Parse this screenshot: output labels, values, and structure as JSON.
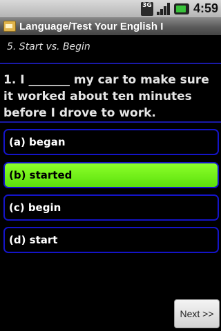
{
  "status": {
    "network": "3G",
    "time": "4:59",
    "icons": [
      "3g-icon",
      "signal-icon",
      "battery-icon"
    ]
  },
  "app": {
    "title": "Language/Test Your English I"
  },
  "section": {
    "subtitle": "5. Start vs. Begin"
  },
  "question": {
    "text": "1. I _______ my car to make sure it worked about ten minutes before I drove to work."
  },
  "options": [
    {
      "label": "(a) began",
      "selected": false
    },
    {
      "label": "(b) started",
      "selected": true
    },
    {
      "label": "(c) begin",
      "selected": false
    },
    {
      "label": "(d) start",
      "selected": false
    }
  ],
  "actions": {
    "next_label": "Next >>"
  },
  "colors": {
    "accent_border": "#1414c8",
    "selected_fill": "#7cf01c",
    "background": "#000000"
  }
}
